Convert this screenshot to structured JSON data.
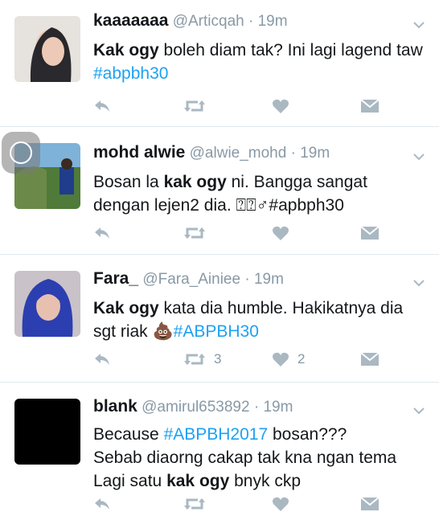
{
  "tweets": [
    {
      "name": "kaaaaaaa",
      "handle": "@Articqah",
      "sep": "·",
      "time": "19m",
      "parts": [
        {
          "t": "b",
          "v": "Kak ogy"
        },
        {
          "t": "n",
          "v": " boleh diam tak? Ini lagi lagend taw "
        },
        {
          "t": "h",
          "v": "#abpbh30"
        }
      ],
      "retweets": "",
      "likes": ""
    },
    {
      "name": "mohd alwie",
      "handle": "@alwie_mohd",
      "sep": "·",
      "time": "19m",
      "parts": [
        {
          "t": "n",
          "v": "Bosan la "
        },
        {
          "t": "b",
          "v": "kak ogy"
        },
        {
          "t": "n",
          "v": " ni. Bangga sangat dengan lejen2 dia. ⍰⍰♂#apbph30"
        }
      ],
      "retweets": "",
      "likes": ""
    },
    {
      "name": "Fara_",
      "handle": "@Fara_Ainiee",
      "sep": "·",
      "time": "19m",
      "parts": [
        {
          "t": "b",
          "v": "Kak ogy"
        },
        {
          "t": "n",
          "v": " kata dia humble. Hakikatnya dia sgt riak 💩"
        },
        {
          "t": "h",
          "v": "#ABPBH30"
        }
      ],
      "retweets": "3",
      "likes": "2"
    },
    {
      "name": "blank",
      "handle": "@amirul653892",
      "sep": "·",
      "time": "19m",
      "parts": [
        {
          "t": "n",
          "v": "Because "
        },
        {
          "t": "h",
          "v": "#ABPBH2017"
        },
        {
          "t": "n",
          "v": " bosan???"
        },
        {
          "t": "br",
          "v": ""
        },
        {
          "t": "n",
          "v": "Sebab diaorng cakap tak kna ngan tema"
        },
        {
          "t": "br",
          "v": ""
        },
        {
          "t": "n",
          "v": "Lagi satu "
        },
        {
          "t": "b",
          "v": "kak ogy"
        },
        {
          "t": "n",
          "v": " bnyk ckp"
        }
      ],
      "retweets": "",
      "likes": ""
    }
  ],
  "colors": {
    "link": "#1da1f2",
    "icon": "#aab8c2",
    "meta": "#8899a6",
    "divider": "#e1e8ed"
  },
  "icons": [
    "reply-icon",
    "retweet-icon",
    "like-icon",
    "direct-message-icon",
    "chevron-down-icon"
  ]
}
